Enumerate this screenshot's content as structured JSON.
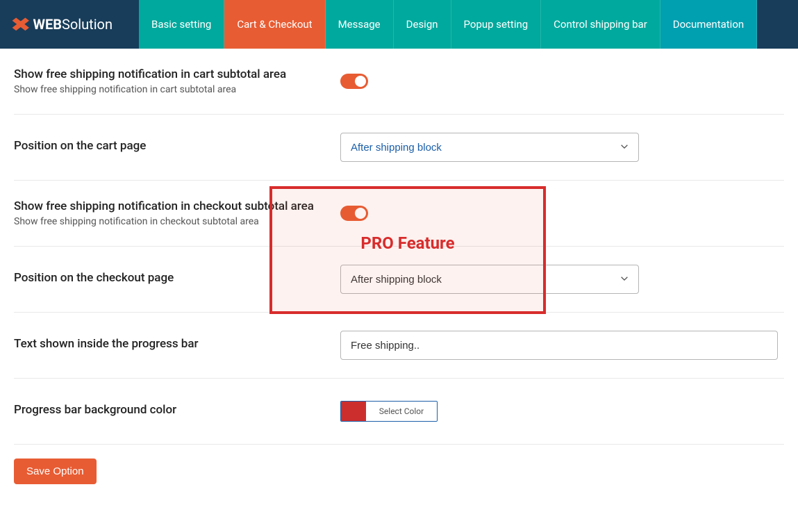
{
  "brand": {
    "web": "WEB",
    "solution": "Solution"
  },
  "nav": {
    "items": [
      "Basic setting",
      "Cart & Checkout",
      "Message",
      "Design",
      "Popup setting",
      "Control shipping bar",
      "Documentation"
    ]
  },
  "settings": {
    "cart_notification": {
      "title": "Show free shipping notification in cart subtotal area",
      "desc": "Show free shipping notification in cart subtotal area"
    },
    "cart_position": {
      "title": "Position on the cart page",
      "value": "After shipping block"
    },
    "checkout_notification": {
      "title": "Show free shipping notification in checkout subtotal area",
      "desc": "Show free shipping notification in checkout subtotal area"
    },
    "checkout_position": {
      "title": "Position on the checkout page",
      "value": "After shipping block"
    },
    "progress_text": {
      "title": "Text shown inside the progress bar",
      "value": "Free shipping.."
    },
    "progress_bg": {
      "title": "Progress bar background color",
      "button_label": "Select Color",
      "color": "#cc2e2e"
    }
  },
  "actions": {
    "save": "Save Option"
  },
  "pro": {
    "title": "PRO Feature"
  }
}
